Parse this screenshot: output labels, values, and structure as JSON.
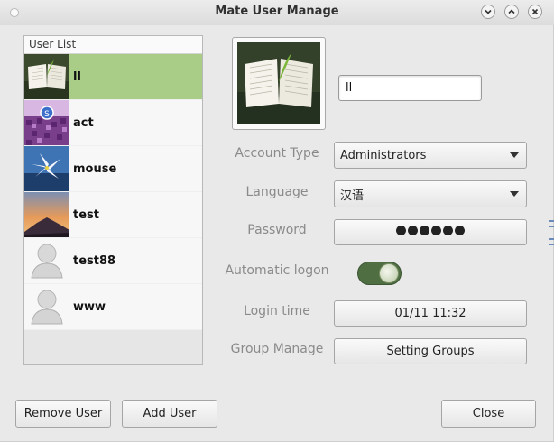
{
  "window": {
    "title": "Mate User Manage"
  },
  "user_list": {
    "header": "User List",
    "users": [
      {
        "name": "ll",
        "avatar": "book-photo",
        "selected": true
      },
      {
        "name": "act",
        "avatar": "purple-mosaic"
      },
      {
        "name": "mouse",
        "avatar": "lily-flower"
      },
      {
        "name": "test",
        "avatar": "mountain-sunset"
      },
      {
        "name": "test88",
        "avatar": "default-person"
      },
      {
        "name": "www",
        "avatar": "default-person"
      }
    ]
  },
  "details": {
    "username_value": "ll",
    "account_type": {
      "label": "Account Type",
      "value": "Administrators"
    },
    "language": {
      "label": "Language",
      "value": "汉语"
    },
    "password": {
      "label": "Password",
      "mask_count": 6
    },
    "automatic_logon": {
      "label": "Automatic logon",
      "enabled": true
    },
    "login_time": {
      "label": "Login time",
      "value": "01/11 11:32"
    },
    "group_manage": {
      "label": "Group Manage",
      "button": "Setting Groups"
    }
  },
  "footer": {
    "remove_user": "Remove User",
    "add_user": "Add User",
    "close": "Close"
  },
  "colors": {
    "selected_row": "#a9cd86",
    "toggle_on": "#4f6f43"
  }
}
